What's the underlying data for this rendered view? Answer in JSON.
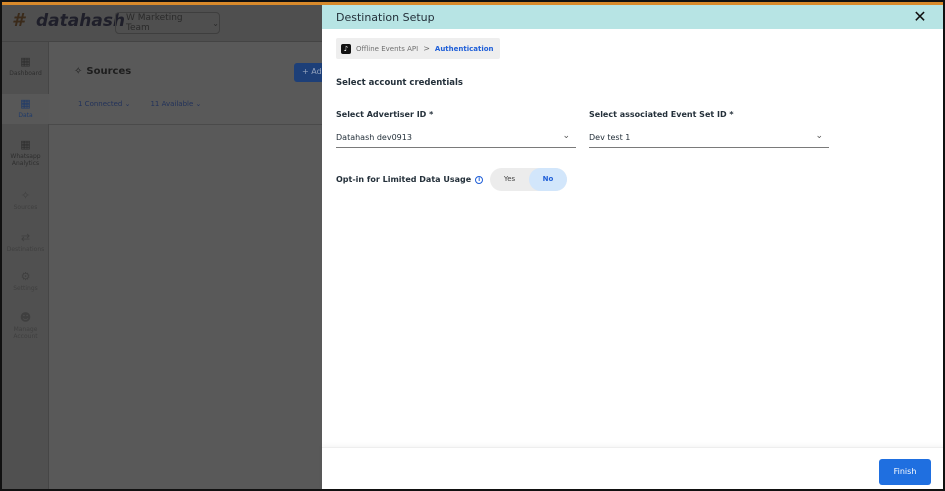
{
  "app": {
    "logo_text": "datahash",
    "team_select": "W Marketing Team",
    "sidebar": [
      {
        "label": "Dashboard",
        "icon": "grid-icon",
        "active": false
      },
      {
        "label": "Data",
        "icon": "grid-icon",
        "active": true
      },
      {
        "label": "Whatsapp Analytics",
        "icon": "grid-icon",
        "active": false
      },
      {
        "label": "Sources",
        "icon": "nodes-icon",
        "active": false
      },
      {
        "label": "Destinations",
        "icon": "share-icon",
        "active": false
      },
      {
        "label": "Settings",
        "icon": "gear-icon",
        "active": false
      },
      {
        "label": "Manage Account",
        "icon": "users-icon",
        "active": false
      }
    ],
    "page_title": "Sources",
    "add_button": "+ Ad",
    "filters": [
      "1 Connected",
      "11 Available"
    ]
  },
  "drawer": {
    "title": "Destination Setup",
    "breadcrumb": {
      "source": "Offline Events API",
      "separator": ">",
      "current": "Authentication"
    },
    "section_label": "Select account credentials",
    "advertiser": {
      "label": "Select Advertiser ID *",
      "value": "Datahash dev0913"
    },
    "event_set": {
      "label": "Select associated Event Set ID *",
      "value": "Dev test 1"
    },
    "optin": {
      "label": "Opt-in for Limited Data Usage",
      "yes": "Yes",
      "no": "No",
      "selected": "No"
    },
    "finish_button": "Finish"
  },
  "colors": {
    "header_bg": "#b7e4e4",
    "accent_blue": "#1f6fe0",
    "toggle_selected_bg": "#d2e6fb",
    "top_accent_line": "#d98a2b"
  }
}
